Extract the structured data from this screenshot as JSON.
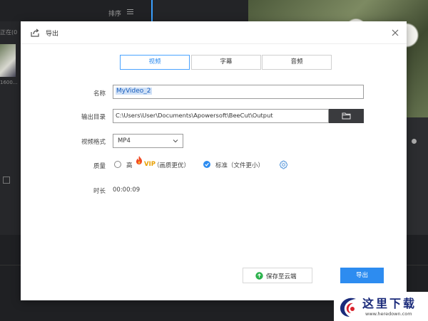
{
  "background": {
    "sort_label": "排序",
    "side_text": "正在(0",
    "thumb_label": "1600..."
  },
  "dialog": {
    "title": "导出",
    "tabs": [
      {
        "label": "视频",
        "active": true
      },
      {
        "label": "字幕",
        "active": false
      },
      {
        "label": "音频",
        "active": false
      }
    ],
    "fields": {
      "name_label": "名称",
      "name_value": "MyVideo_2",
      "output_dir_label": "输出目录",
      "output_dir_value": "C:\\Users\\User\\Documents\\Apowersoft\\BeeCut\\Output",
      "format_label": "视频格式",
      "format_value": "MP4",
      "quality_label": "质量",
      "quality_high": "高",
      "quality_vip": "VIP",
      "quality_high_desc": "（画质更优）",
      "quality_standard": "标准（文件更小）",
      "quality_selected": "standard",
      "duration_label": "时长",
      "duration_value": "00:00:09"
    },
    "buttons": {
      "save_cloud": "保存至云端",
      "export": "导出"
    }
  },
  "watermark": {
    "cn": "这里下载",
    "url": "www.heredown.com"
  },
  "colors": {
    "accent": "#2d8cf0",
    "vip": "#e8a000",
    "cloud_green": "#2bb24c"
  }
}
